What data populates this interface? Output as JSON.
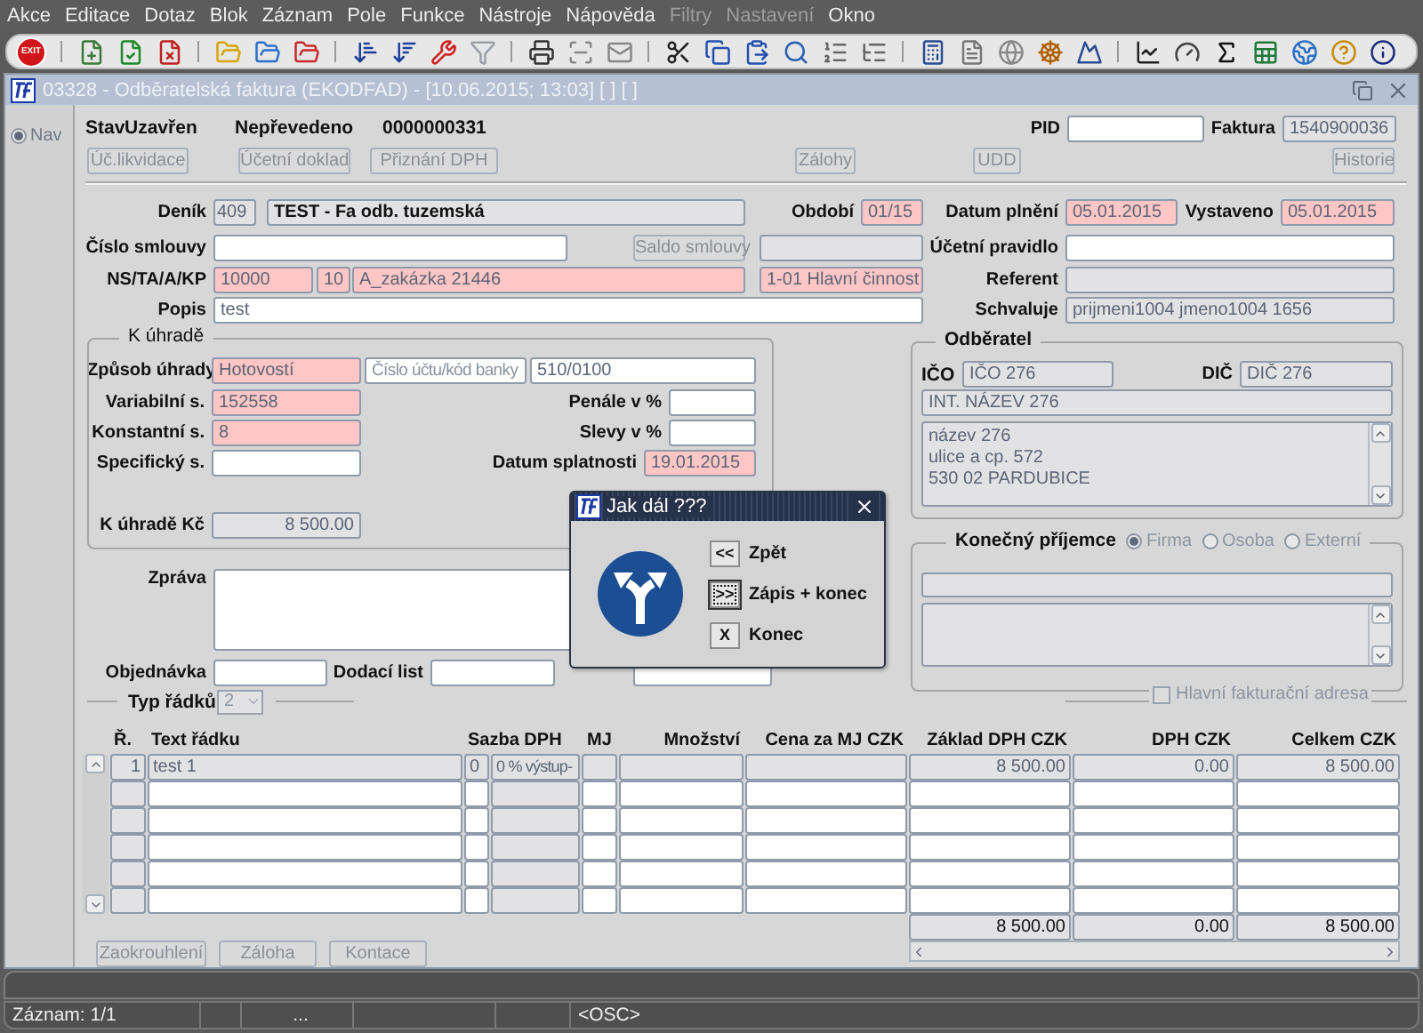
{
  "menu": [
    {
      "label": "Akce",
      "disabled": false
    },
    {
      "label": "Editace",
      "disabled": false
    },
    {
      "label": "Dotaz",
      "disabled": false
    },
    {
      "label": "Blok",
      "disabled": false
    },
    {
      "label": "Záznam",
      "disabled": false
    },
    {
      "label": "Pole",
      "disabled": false
    },
    {
      "label": "Funkce",
      "disabled": false
    },
    {
      "label": "Nástroje",
      "disabled": false
    },
    {
      "label": "Nápověda",
      "disabled": false
    },
    {
      "label": "Filtry",
      "disabled": true
    },
    {
      "label": "Nastavení",
      "disabled": true
    },
    {
      "label": "Okno",
      "disabled": false
    }
  ],
  "toolbar": {
    "exit": "EXIT"
  },
  "window": {
    "title": "03328 - Odběratelská faktura (EKODFAD) - [10.06.2015; 13:03] [ ] [ ]"
  },
  "nav": {
    "label": "Nav",
    "selected": true
  },
  "header": {
    "status_label": "Stav",
    "status": "Uzavřen",
    "transfer": "Nepřevedeno",
    "number": "0000000331",
    "pid": {
      "label": "PID",
      "kind": "input"
    },
    "invoice": {
      "label": "Faktura",
      "value": "1540900036",
      "kind": "readonly"
    }
  },
  "top_actions": [
    {
      "label": "Úč.likvidace",
      "disabled": true
    },
    {
      "label": "Účetní doklad",
      "disabled": true
    },
    {
      "label": "Přiznání DPH",
      "disabled": true
    },
    {
      "label": "Zálohy",
      "disabled": true
    },
    {
      "label": "UDD",
      "disabled": true
    },
    {
      "label": "Historie",
      "disabled": true
    }
  ],
  "journal": {
    "label": "Deník",
    "code": "409",
    "name": "TEST - Fa odb. tuzemská"
  },
  "period": {
    "label": "Období",
    "value": "01/15",
    "kind": "required"
  },
  "performance_date": {
    "label": "Datum plnění",
    "value": "05.01.2015",
    "kind": "required"
  },
  "issued": {
    "label": "Vystaveno",
    "value": "05.01.2015",
    "kind": "required"
  },
  "contract": {
    "label": "Číslo smlouvy",
    "kind": "input"
  },
  "contract_balance": {
    "label": "Saldo smlouvy",
    "disabled": true
  },
  "accounting_rule": {
    "label": "Účetní pravidlo",
    "kind": "input"
  },
  "cost_center": {
    "label": "NS/TA/A/KP",
    "parts": [
      {
        "value": "10000",
        "kind": "required"
      },
      {
        "value": "10",
        "kind": "required"
      },
      {
        "value": "A_zakázka 21446",
        "kind": "required"
      },
      {
        "value": "1-01 Hlavní činnost",
        "kind": "required"
      }
    ]
  },
  "referent": {
    "label": "Referent",
    "kind": "readonly"
  },
  "description": {
    "label": "Popis",
    "value": "test",
    "kind": "input"
  },
  "approver": {
    "label": "Schvaluje",
    "value": "prijmeni1004 jmeno1004 1656",
    "kind": "readonly"
  },
  "payment": {
    "title": "K úhradě",
    "method": {
      "label": "Způsob úhrady",
      "value": "Hotovostí",
      "kind": "required"
    },
    "account": {
      "placeholder": "Číslo účtu/kód banky",
      "kind": "input"
    },
    "bank": {
      "value": "510/0100",
      "kind": "input"
    },
    "variable_symbol": {
      "label": "Variabilní s.",
      "value": "152558",
      "kind": "required"
    },
    "constant_symbol": {
      "label": "Konstantní s.",
      "value": "8",
      "kind": "required"
    },
    "specific_symbol": {
      "label": "Specifický s.",
      "kind": "input"
    },
    "penalty": {
      "label": "Penále v %",
      "kind": "input"
    },
    "discount": {
      "label": "Slevy v %",
      "kind": "input"
    },
    "due_date": {
      "label": "Datum splatnosti",
      "value": "19.01.2015",
      "kind": "required"
    },
    "amount": {
      "label": "K úhradě Kč",
      "value": "8 500.00",
      "kind": "readonly"
    }
  },
  "message": {
    "label": "Zpráva"
  },
  "order": {
    "label": "Objednávka"
  },
  "delivery_note": {
    "label": "Dodací list"
  },
  "customer": {
    "title": "Odběratel",
    "ico": {
      "label": "IČO",
      "value": "IČO 276"
    },
    "dic": {
      "label": "DIČ",
      "value": "DIČ 276"
    },
    "intl_name": "INT. NÁZEV 276",
    "address": [
      "název 276",
      "ulice a cp. 572",
      "530 02 PARDUBICE"
    ]
  },
  "recipient": {
    "title": "Konečný příjemce",
    "options": [
      {
        "label": "Firma",
        "selected": true
      },
      {
        "label": "Osoba",
        "selected": false
      },
      {
        "label": "Externí",
        "selected": false
      }
    ],
    "main_address": {
      "label": "Hlavní fakturační adresa",
      "checked": false
    }
  },
  "line_type": {
    "label": "Typ řádků",
    "value": "2",
    "disabled": true
  },
  "table": {
    "columns": [
      "Ř.",
      "Text řádku",
      "Sazba DPH",
      "MJ",
      "Množství",
      "Cena za MJ CZK",
      "Základ DPH CZK",
      "DPH CZK",
      "Celkem CZK"
    ],
    "rows": [
      {
        "number": "1",
        "text": "test 1",
        "vat_code": "0",
        "vat_name": "0 % výstup-",
        "base": "8 500.00",
        "vat": "0.00",
        "total": "8 500.00",
        "locked": true
      }
    ],
    "totals": {
      "base": "8 500.00",
      "vat": "0.00",
      "total": "8 500.00"
    }
  },
  "bottom_actions": [
    {
      "label": "Zaokrouhlení",
      "disabled": true
    },
    {
      "label": "Záloha",
      "disabled": true
    },
    {
      "label": "Kontace",
      "disabled": true
    }
  ],
  "dialog": {
    "title": "Jak dál ???",
    "options": [
      {
        "key": "<<",
        "label": "Zpět",
        "selected": false
      },
      {
        "key": ">>",
        "label": "Zápis + konec",
        "selected": true
      },
      {
        "key": "X",
        "label": "Konec",
        "selected": false
      }
    ]
  },
  "status_bar": {
    "record": "Záznam: 1/1",
    "ellipsis": "...",
    "mode": "<OSC>"
  }
}
